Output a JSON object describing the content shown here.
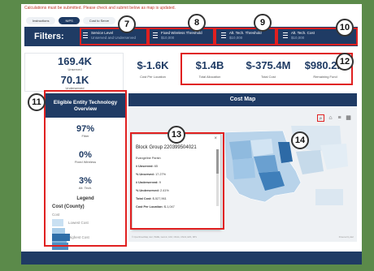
{
  "banner": "Calculations must be submitted. Please check and submit below as map is updated.",
  "toggles": [
    "Instructions",
    "NIPS",
    "Cost to Serve"
  ],
  "filters": {
    "label": "Filters:",
    "items": [
      {
        "title": "Service Level",
        "value": "Unserved and Underserved"
      },
      {
        "title": "Fixed Wireless Threshold",
        "value": "$10,000"
      },
      {
        "title": "Alt. Tech. Threshold",
        "value": "$10,000"
      },
      {
        "title": "Alt. Tech. Cost",
        "value": "$10,000"
      }
    ]
  },
  "left_stats": [
    {
      "value": "169.4K",
      "label": "Unserved"
    },
    {
      "value": "70.1K",
      "label": "Underserved"
    }
  ],
  "kpis": [
    {
      "value": "$-1.6K",
      "label": "Cost Per Location"
    },
    {
      "value": "$1.4B",
      "label": "Total Allocation"
    },
    {
      "value": "$-375.4M",
      "label": "Total Cost"
    },
    {
      "value": "$980.2M",
      "label": "Remaining Fund"
    }
  ],
  "panel": {
    "title": "Eligible Entity Technology Overview",
    "stats": [
      {
        "value": "97%",
        "label": "Fiber"
      },
      {
        "value": "0%",
        "label": "Fixed Wireless"
      },
      {
        "value": "3%",
        "label": "Alt. Tech."
      }
    ],
    "legend_title": "Legend",
    "legend_sub": "Cost (County)",
    "legend_cost": "Cost",
    "legend_low": "Lowest Cost",
    "legend_high": "Highest Cost"
  },
  "map": {
    "title": "Cost Map",
    "attribution": "© OpenStreetMap, Esri, HERE, Garmin, FAO, NOAA, USGS, EPA, NPS",
    "powered": "Powered by Esri",
    "popup": {
      "title": "Block Group 220399504021",
      "rows": [
        {
          "k": "",
          "v": "Evangeline Parish"
        },
        {
          "k": "# Unserved:",
          "v": " 65"
        },
        {
          "k": "% Unserved:",
          "v": " 17.27%"
        },
        {
          "k": "# Underserved:",
          "v": " 9"
        },
        {
          "k": "% Underserved:",
          "v": " 2.41%"
        },
        {
          "k": "Total Cost:",
          "v": " $-527,961"
        },
        {
          "k": "Cost Per Location:",
          "v": " $-1,047"
        }
      ]
    }
  },
  "badges": [
    "7",
    "8",
    "9",
    "10",
    "11",
    "12",
    "13",
    "14"
  ],
  "colors": {
    "navy": "#1f3b64",
    "annotation_red": "#e02020",
    "page_bg": "#5b8a4a"
  }
}
